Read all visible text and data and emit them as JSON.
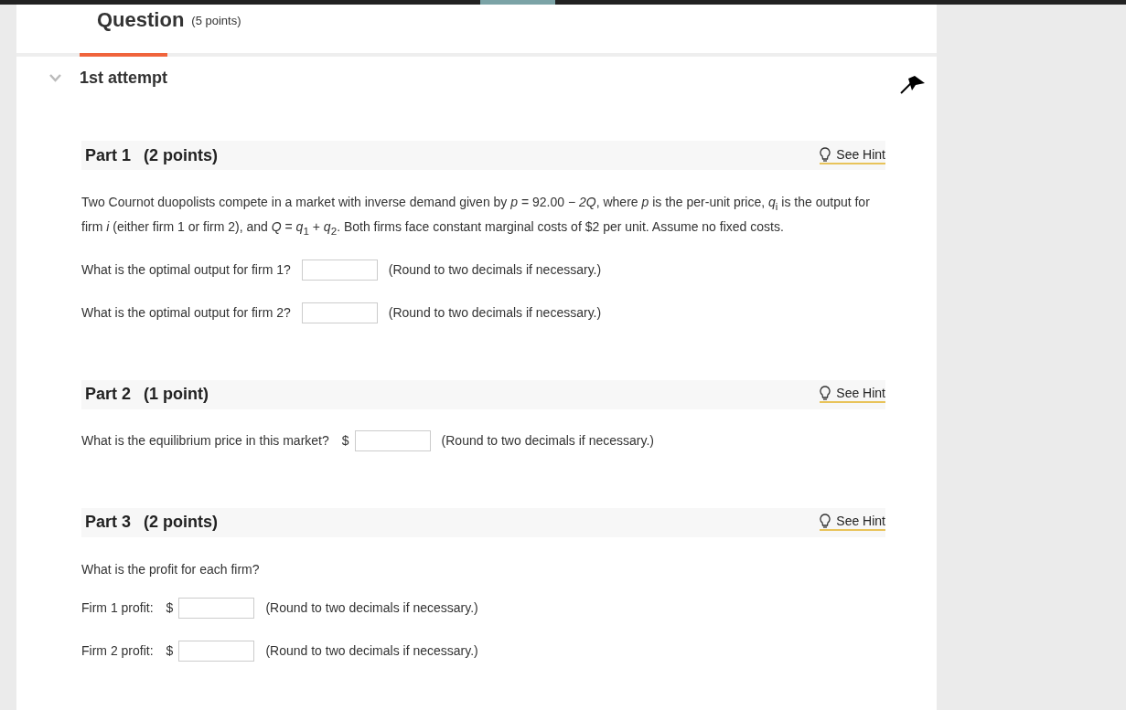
{
  "header": {
    "title": "Question",
    "points": "(5 points)"
  },
  "attempt": {
    "label": "1st attempt",
    "expanded": true
  },
  "parts": [
    {
      "title": "Part 1",
      "points": "(2 points)",
      "hint": "See Hint",
      "intro": "Two Cournot duopolists compete in a market with inverse demand given by *p* = 92.00 − *2Q*, where *p* is the per-unit price, *q*$_{i}$ is the output for firm *i* (either firm 1 or firm 2), and *Q* = *q*$_{1}$ + *q*$_{2}$. Both firms face constant marginal costs of $2 per unit. Assume no fixed costs.",
      "questions": [
        {
          "label": "What is the optimal output for firm 1?",
          "note": "(Round to two decimals if necessary.)"
        },
        {
          "label": "What is the optimal output for firm 2?",
          "note": "(Round to two decimals if necessary.)"
        }
      ]
    },
    {
      "title": "Part 2",
      "points": "(1 point)",
      "hint": "See Hint",
      "questions": [
        {
          "label": "What is the equilibrium price in this market?",
          "prefix": "$",
          "note": "(Round to two decimals if necessary.)"
        }
      ]
    },
    {
      "title": "Part 3",
      "points": "(2 points)",
      "hint": "See Hint",
      "intro": "What is the profit for each firm?",
      "questions": [
        {
          "label": "Firm 1 profit:",
          "prefix": "$",
          "note": "(Round to two decimals if necessary.)"
        },
        {
          "label": "Firm 2 profit:",
          "prefix": "$",
          "note": "(Round to two decimals if necessary.)"
        }
      ]
    }
  ]
}
